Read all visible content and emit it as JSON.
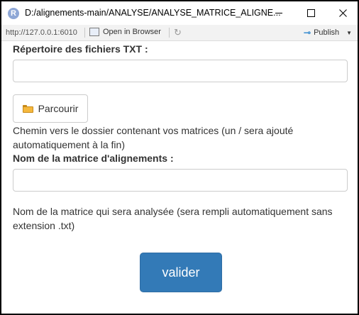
{
  "window": {
    "app_icon_letter": "R",
    "title": "D:/alignements-main/ANALYSE/ANALYSE_MATRICE_ALIGNE..."
  },
  "toolbar": {
    "url": "http://127.0.0.1:6010",
    "open_in_browser": "Open in Browser",
    "publish": "Publish"
  },
  "form": {
    "dir_label": "Répertoire des fichiers TXT :",
    "dir_value": "",
    "browse_label": "Parcourir",
    "dir_help": "Chemin vers le dossier contenant vos matrices (un / sera ajouté automatiquement à la fin)",
    "matrix_label": "Nom de la matrice d'alignements :",
    "matrix_value": "",
    "matrix_help": "Nom de la matrice qui sera analysée (sera rempli automatiquement sans extension .txt)",
    "submit_label": "valider"
  },
  "colors": {
    "primary_button": "#337ab7",
    "publish_icon": "#3a8ed0"
  },
  "icons": [
    "r-app-icon",
    "minimize-icon",
    "maximize-icon",
    "close-icon",
    "open-in-browser-icon",
    "refresh-icon",
    "publish-icon",
    "folder-icon"
  ]
}
